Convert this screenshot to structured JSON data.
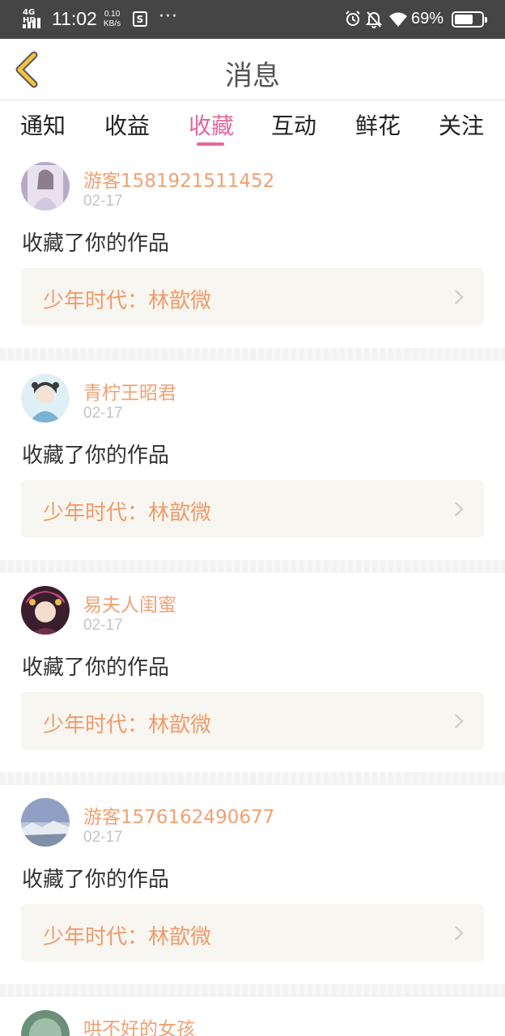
{
  "status_bar": {
    "network": "4G HD",
    "time": "11:02",
    "speed_value": "0.10",
    "speed_unit": "KB/s",
    "s_icon_letter": "S",
    "more": "···",
    "battery_percent": "69%",
    "battery_level": 0.69
  },
  "nav": {
    "title": "消息",
    "back_icon": "chevron-left-icon",
    "accent_color": "#f2c044"
  },
  "tabs": [
    {
      "label": "通知",
      "active": false
    },
    {
      "label": "收益",
      "active": false
    },
    {
      "label": "收藏",
      "active": true
    },
    {
      "label": "互动",
      "active": false
    },
    {
      "label": "鲜花",
      "active": false
    },
    {
      "label": "关注",
      "active": false
    }
  ],
  "colors": {
    "active_tab": "#e4679b",
    "username": "#f0a173",
    "work_title": "#ef9b6b",
    "work_bg": "#f8f6f0",
    "status_bar_bg": "#454545"
  },
  "feed": [
    {
      "username": "游客1581921511452",
      "date": "02-17",
      "message": "收藏了你的作品",
      "work": "少年时代：林歆微"
    },
    {
      "username": "青柠王昭君",
      "date": "02-17",
      "message": "收藏了你的作品",
      "work": "少年时代：林歆微"
    },
    {
      "username": "易夫人闺蜜",
      "date": "02-17",
      "message": "收藏了你的作品",
      "work": "少年时代：林歆微"
    },
    {
      "username": "游客1576162490677",
      "date": "02-17",
      "message": "收藏了你的作品",
      "work": "少年时代：林歆微"
    },
    {
      "username": "哄不好的女孩",
      "date": "",
      "message": "",
      "work": ""
    }
  ]
}
